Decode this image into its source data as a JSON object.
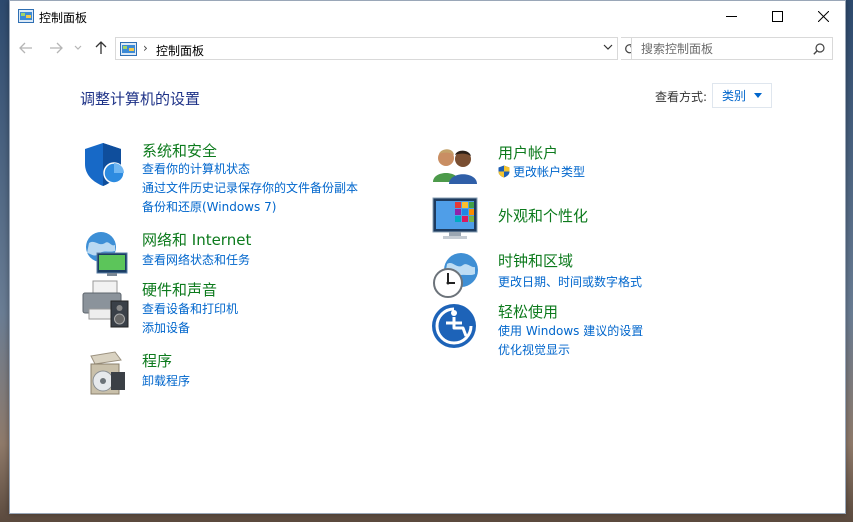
{
  "window": {
    "title": "控制面板"
  },
  "nav": {
    "address_text": "控制面板",
    "address_separator": "›",
    "search_placeholder": "搜索控制面板"
  },
  "content": {
    "page_title": "调整计算机的设置",
    "view_by_label": "查看方式:",
    "view_by_value": "类别"
  },
  "categories": {
    "system_security": {
      "title": "系统和安全",
      "links": [
        "查看你的计算机状态",
        "通过文件历史记录保存你的文件备份副本",
        "备份和还原(Windows 7)"
      ]
    },
    "network": {
      "title": "网络和 Internet",
      "links": [
        "查看网络状态和任务"
      ]
    },
    "hardware_sound": {
      "title": "硬件和声音",
      "links": [
        "查看设备和打印机",
        "添加设备"
      ]
    },
    "programs": {
      "title": "程序",
      "links": [
        "卸载程序"
      ]
    },
    "user_accounts": {
      "title": "用户帐户",
      "links": [
        "更改帐户类型"
      ]
    },
    "appearance": {
      "title": "外观和个性化",
      "links": []
    },
    "clock_region": {
      "title": "时钟和区域",
      "links": [
        "更改日期、时间或数字格式"
      ]
    },
    "ease_of_access": {
      "title": "轻松使用",
      "links": [
        "使用 Windows 建议的设置",
        "优化视觉显示"
      ]
    }
  },
  "colors": {
    "category_title": "#0c7a1c",
    "link": "#0066cc",
    "page_title": "#1e3287"
  }
}
